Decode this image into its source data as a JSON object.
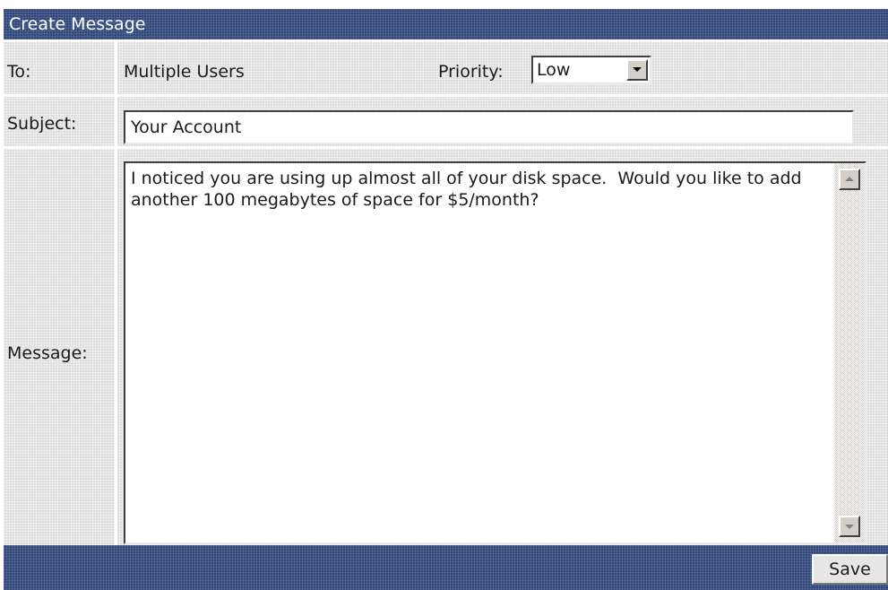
{
  "dialog": {
    "title": "Create Message"
  },
  "to": {
    "label": "To:",
    "value": "Multiple Users"
  },
  "priority": {
    "label": "Priority:",
    "selected": "Low"
  },
  "subject": {
    "label": "Subject:",
    "value": "Your Account"
  },
  "message": {
    "label": "Message:",
    "value": "I noticed you are using up almost all of your disk space.  Would you like to add another 100 megabytes of space for $5/month?"
  },
  "footer": {
    "save_label": "Save"
  },
  "colors": {
    "header_bar": "#31487a",
    "panel_background": "#dedede",
    "field_background": "#ffffff"
  },
  "icons": {
    "priority_dropdown": "chevron-down-icon",
    "scroll_up": "arrow-up-icon",
    "scroll_down": "arrow-down-icon"
  }
}
